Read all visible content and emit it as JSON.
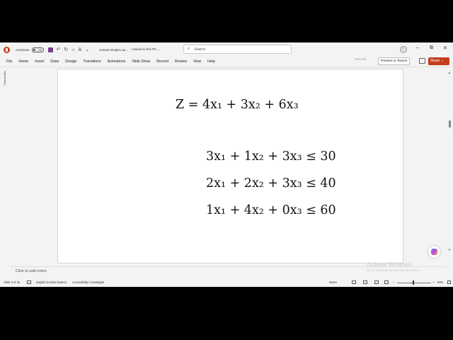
{
  "titlebar": {
    "autosave_label": "AutoSave",
    "autosave_state": "Off",
    "filename": "revised simplex qu...",
    "saved_status": "• Saved to this PC ⌄",
    "search_placeholder": "Search",
    "win_min": "–",
    "win_max": "⧉",
    "win_close": "✕"
  },
  "menu": {
    "items": [
      "File",
      "Home",
      "Insert",
      "Draw",
      "Design",
      "Transitions",
      "Animations",
      "Slide Show",
      "Record",
      "Review",
      "View",
      "Help"
    ],
    "record_label": "Record",
    "present_label": "Present in Teams",
    "share_label": "Share ⌄"
  },
  "thumbnails_label": "Thumbnails",
  "slide": {
    "objective": "Z = 4x₁ + 3x₂ + 6x₃",
    "constraints": [
      "3x₁ + 1x₂ + 3x₃ ≤ 30",
      "2x₁ + 2x₂ + 3x₃ ≤ 40",
      "1x₁ + 4x₂ + 0x₃ ≤ 60"
    ]
  },
  "notes_placeholder": "Click to add notes",
  "watermark": {
    "line1": "Activate Windows",
    "line2": "Go to Settings to activate Windows."
  },
  "statusbar": {
    "slide_info": "Slide 8 of 25",
    "language": "English (United States)",
    "accessibility": "Accessibility: Investigate",
    "notes_btn": "Notes",
    "zoom": "83%"
  },
  "colors": {
    "accent": "#c43e1c",
    "background": "#f3f3f3"
  }
}
